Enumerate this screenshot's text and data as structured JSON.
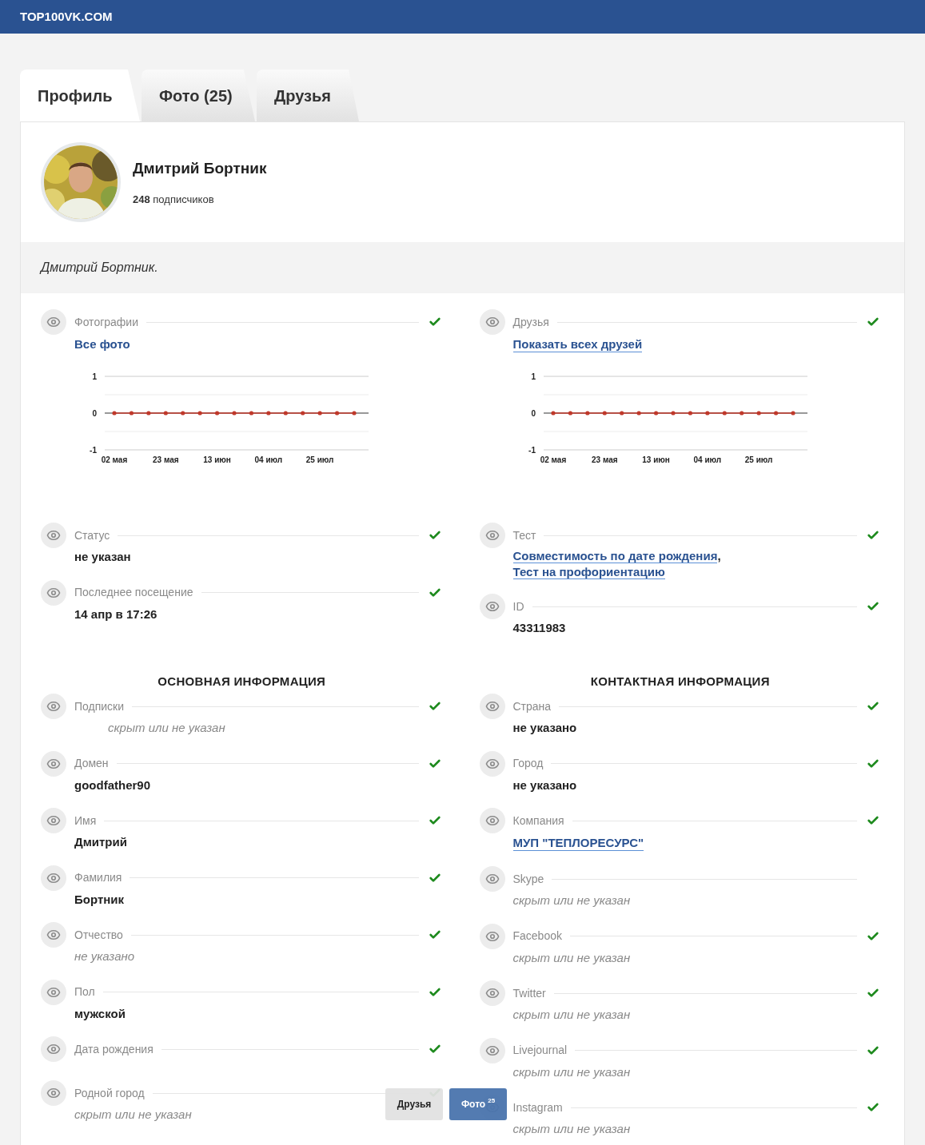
{
  "site": {
    "logo": "TOP100VK.COM"
  },
  "tabs": [
    {
      "label": "Профиль",
      "selected": true
    },
    {
      "label": "Фото (25)",
      "selected": false
    },
    {
      "label": "Друзья",
      "selected": false
    }
  ],
  "profile": {
    "name": "Дмитрий Бортник",
    "subscribers_count": "248",
    "subscribers_label": "подписчиков",
    "status_text": "Дмитрий Бортник."
  },
  "overview": {
    "left": [
      {
        "label": "Фотографии",
        "checked": true,
        "value": {
          "kind": "link",
          "text": "Все фото",
          "underlined": false
        },
        "chart_data": {
          "type": "line",
          "categories": [
            "02 мая",
            null,
            null,
            "23 мая",
            null,
            null,
            "13 июн",
            null,
            null,
            "04 июл",
            null,
            null,
            "25 июл",
            null,
            null
          ],
          "ylim": [
            -1,
            1
          ],
          "yticks": [
            -1,
            0,
            1
          ],
          "ref_lines": [
            {
              "axis": "y",
              "value": -0.5
            },
            {
              "axis": "y",
              "value": 0.5
            }
          ],
          "series": [
            {
              "color": "#c0392b",
              "values": [
                0,
                0,
                0,
                0,
                0,
                0,
                0,
                0,
                0,
                0,
                0,
                0,
                0,
                0,
                0
              ]
            }
          ]
        }
      },
      {
        "label": "Статус",
        "checked": true,
        "value": {
          "kind": "bold",
          "text": "не указан"
        }
      },
      {
        "label": "Последнее посещение",
        "checked": true,
        "value": {
          "kind": "bold",
          "text": "14 апр в 17:26"
        }
      }
    ],
    "right": [
      {
        "label": "Друзья",
        "checked": true,
        "value": {
          "kind": "link",
          "text": "Показать всех друзей",
          "underlined": true
        },
        "chart_data": {
          "type": "line",
          "categories": [
            "02 мая",
            null,
            null,
            "23 мая",
            null,
            null,
            "13 июн",
            null,
            null,
            "04 июл",
            null,
            null,
            "25 июл",
            null,
            null
          ],
          "ylim": [
            -1,
            1
          ],
          "yticks": [
            -1,
            0,
            1
          ],
          "ref_lines": [
            {
              "axis": "y",
              "value": -0.5
            },
            {
              "axis": "y",
              "value": 0.5
            }
          ],
          "series": [
            {
              "color": "#c0392b",
              "values": [
                0,
                0,
                0,
                0,
                0,
                0,
                0,
                0,
                0,
                0,
                0,
                0,
                0,
                0,
                0
              ]
            }
          ]
        }
      },
      {
        "label": "Тест",
        "checked": true,
        "value": {
          "kind": "links",
          "links": [
            "Совместимость по дате рождения",
            "Тест на профориентацию"
          ],
          "separator": ","
        }
      },
      {
        "label": "ID",
        "checked": true,
        "value": {
          "kind": "bold",
          "text": "43311983"
        }
      }
    ]
  },
  "sections": [
    {
      "title": "ОСНОВНАЯ ИНФОРМАЦИЯ",
      "fields": [
        {
          "label": "Подписки",
          "checked": true,
          "value": {
            "kind": "muted",
            "text": "скрыт или не указан",
            "indented": true
          }
        },
        {
          "label": "Домен",
          "checked": true,
          "value": {
            "kind": "bold",
            "text": "goodfather90"
          }
        },
        {
          "label": "Имя",
          "checked": true,
          "value": {
            "kind": "bold",
            "text": "Дмитрий"
          }
        },
        {
          "label": "Фамилия",
          "checked": true,
          "value": {
            "kind": "bold",
            "text": "Бортник"
          }
        },
        {
          "label": "Отчество",
          "checked": true,
          "value": {
            "kind": "muted",
            "text": "не указано"
          }
        },
        {
          "label": "Пол",
          "checked": true,
          "value": {
            "kind": "bold",
            "text": "мужской"
          }
        },
        {
          "label": "Дата рождения",
          "checked": true
        },
        {
          "label": "Родной город",
          "checked": true,
          "value": {
            "kind": "muted",
            "text": "скрыт или не указан"
          }
        }
      ]
    },
    {
      "title": "КОНТАКТНАЯ ИНФОРМАЦИЯ",
      "fields": [
        {
          "label": "Страна",
          "checked": true,
          "value": {
            "kind": "bold",
            "text": "не указано"
          }
        },
        {
          "label": "Город",
          "checked": true,
          "value": {
            "kind": "bold",
            "text": "не указано"
          }
        },
        {
          "label": "Компания",
          "checked": true,
          "value": {
            "kind": "link",
            "text": "МУП \"ТЕПЛОРЕСУРС\"",
            "underlined": true
          }
        },
        {
          "label": "Skype",
          "checked": false,
          "value": {
            "kind": "muted",
            "text": "скрыт или не указан"
          }
        },
        {
          "label": "Facebook",
          "checked": true,
          "value": {
            "kind": "muted",
            "text": "скрыт или не указан"
          }
        },
        {
          "label": "Twitter",
          "checked": true,
          "value": {
            "kind": "muted",
            "text": "скрыт или не указан"
          }
        },
        {
          "label": "Livejournal",
          "checked": true,
          "value": {
            "kind": "muted",
            "text": "скрыт или не указан"
          }
        },
        {
          "label": "Instagram",
          "checked": true,
          "value": {
            "kind": "muted",
            "text": "скрыт или не указан"
          }
        }
      ]
    }
  ],
  "floating_buttons": [
    {
      "kind": "secondary",
      "label": "Друзья"
    },
    {
      "kind": "primary",
      "label": "Фото",
      "badge": "25"
    }
  ]
}
